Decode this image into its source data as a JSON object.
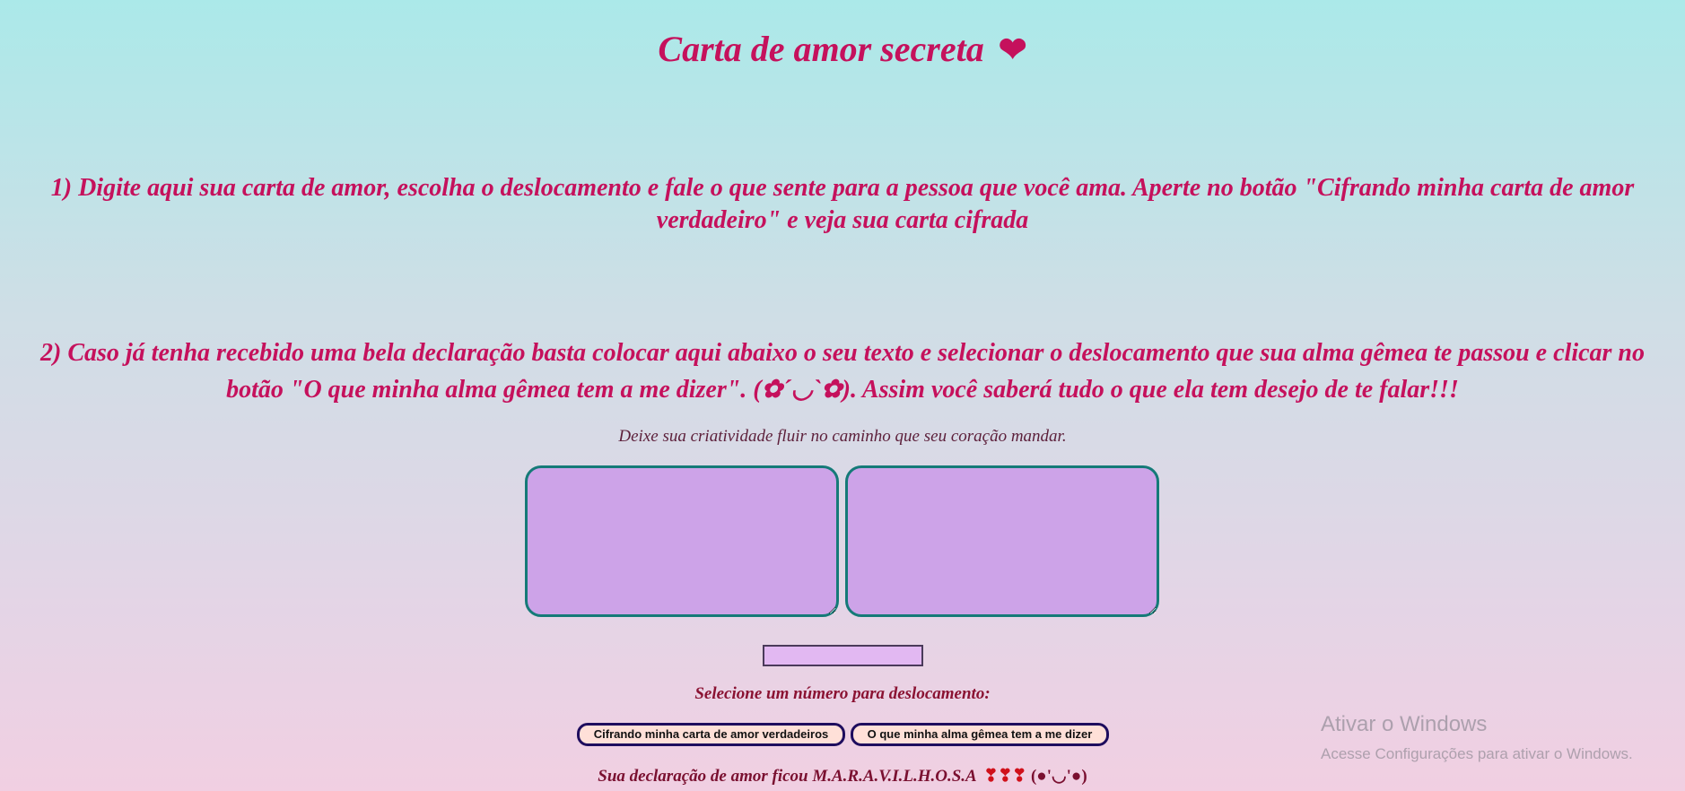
{
  "page": {
    "title": "Carta de amor secreta",
    "title_icon": "heart-icon",
    "title_heart": "❤"
  },
  "instructions": {
    "step1": "1) Digite aqui sua carta de amor, escolha o deslocamento e fale o que sente para a pessoa que você ama. Aperte no botão \"Cifrando minha carta de amor verdadeiro\" e veja sua carta cifrada",
    "step2": "2) Caso já tenha recebido uma bela declaração basta colocar aqui abaixo o seu texto e selecionar o deslocamento que sua alma gêmea te passou e clicar no botão \"O que minha alma gêmea tem a me dizer\". (✿´◡`✿). Assim você saberá tudo o que ela tem desejo de te falar!!!"
  },
  "hint": "Deixe sua criatividade fluir no caminho que seu coração mandar.",
  "inputs": {
    "text_in_value": "",
    "text_out_value": "",
    "shift_value": ""
  },
  "select_label": "Selecione um número para deslocamento:",
  "buttons": {
    "encrypt": "Cifrando minha carta de amor verdadeiros",
    "decrypt": "O que minha alma gêmea tem a me dizer"
  },
  "result": {
    "text": "Sua declaração de amor ficou M.A.R.A.V.I.L.H.O.S.A",
    "hearts": "❣❣❣",
    "face": "(●'◡'●)"
  },
  "watermark": {
    "title": "Ativar o Windows",
    "subtitle": "Acesse Configurações para ativar o Windows."
  },
  "colors": {
    "accent": "#c5115c",
    "textarea_bg": "#cda3e8",
    "textarea_border": "#157a78",
    "button_bg": "#ffe0d8",
    "button_border": "#1e0d5e"
  }
}
